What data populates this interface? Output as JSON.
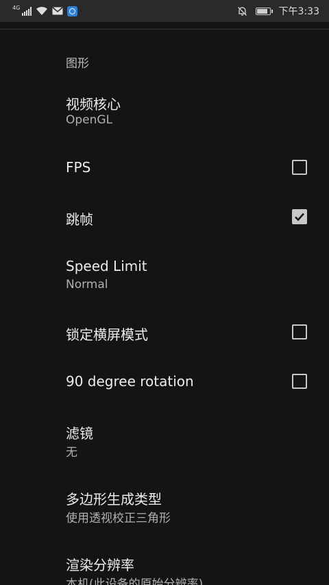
{
  "status_bar": {
    "network": "4G",
    "time": "下午3:33"
  },
  "category": "图形",
  "prefs": [
    {
      "title": "视频核心",
      "summary": "OpenGL"
    },
    {
      "title": "FPS",
      "checked": false
    },
    {
      "title": "跳帧",
      "checked": true
    },
    {
      "title": "Speed Limit",
      "summary": "Normal"
    },
    {
      "title": "锁定横屏模式",
      "checked": false
    },
    {
      "title": "90 degree rotation",
      "checked": false
    },
    {
      "title": "滤镜",
      "summary": "无"
    },
    {
      "title": "多边形生成类型",
      "summary": "使用透视校正三角形"
    },
    {
      "title": "渲染分辨率",
      "summary": "本机(此设备的原始分辨率)"
    }
  ],
  "colors": {
    "background": "#141414",
    "status_bar": "#2a2a2c",
    "checkbox": "#c8c8c8"
  }
}
